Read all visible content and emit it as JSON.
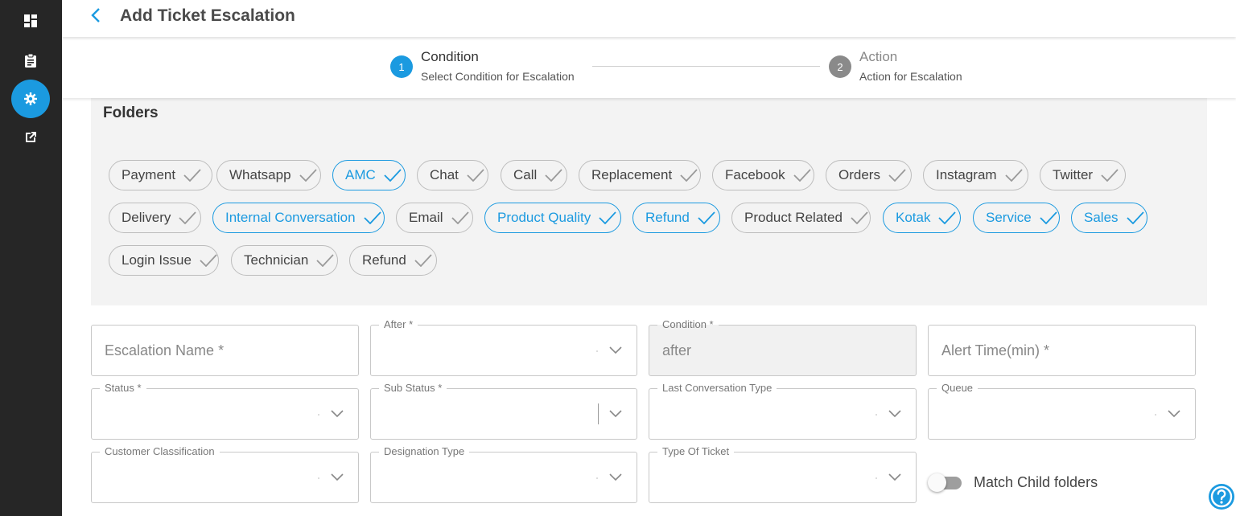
{
  "header": {
    "title": "Add Ticket Escalation"
  },
  "sidebar": {
    "items": [
      {
        "name": "dashboard",
        "icon": "dashboard-icon"
      },
      {
        "name": "tickets",
        "icon": "clipboard-icon"
      },
      {
        "name": "settings",
        "icon": "gear-icon",
        "active": true
      },
      {
        "name": "open-external",
        "icon": "external-link-icon"
      }
    ]
  },
  "stepper": {
    "steps": [
      {
        "number": "1",
        "title": "Condition",
        "subtitle": "Select Condition for Escalation",
        "active": true
      },
      {
        "number": "2",
        "title": "Action",
        "subtitle": "Action for Escalation",
        "active": false
      }
    ]
  },
  "folders": {
    "title": "Folders",
    "chips": [
      {
        "label": "Payment",
        "selected": false
      },
      {
        "label": "Whatsapp",
        "selected": false
      },
      {
        "label": "AMC",
        "selected": true
      },
      {
        "label": "Chat",
        "selected": false
      },
      {
        "label": "Call",
        "selected": false
      },
      {
        "label": "Replacement",
        "selected": false
      },
      {
        "label": "Facebook",
        "selected": false
      },
      {
        "label": "Orders",
        "selected": false
      },
      {
        "label": "Instagram",
        "selected": false
      },
      {
        "label": "Twitter",
        "selected": false
      },
      {
        "label": "Delivery",
        "selected": false
      },
      {
        "label": "Internal Conversation",
        "selected": true
      },
      {
        "label": "Email",
        "selected": false
      },
      {
        "label": "Product Quality",
        "selected": true
      },
      {
        "label": "Refund",
        "selected": true
      },
      {
        "label": "Product Related",
        "selected": false
      },
      {
        "label": "Kotak",
        "selected": true
      },
      {
        "label": "Service",
        "selected": true
      },
      {
        "label": "Sales",
        "selected": true
      },
      {
        "label": "Login Issue",
        "selected": false
      },
      {
        "label": "Technician",
        "selected": false
      },
      {
        "label": "Refund",
        "selected": false
      }
    ]
  },
  "form": {
    "escalation_name": {
      "placeholder": "Escalation Name *",
      "value": ""
    },
    "after": {
      "label": "After *",
      "value": ""
    },
    "condition": {
      "label": "Condition *",
      "value": "after"
    },
    "alert_time": {
      "placeholder": "Alert Time(min) *",
      "value": ""
    },
    "status": {
      "label": "Status *",
      "value": ""
    },
    "sub_status": {
      "label": "Sub Status *",
      "value": ""
    },
    "last_conversation_type": {
      "label": "Last Conversation Type",
      "value": ""
    },
    "queue": {
      "label": "Queue",
      "value": ""
    },
    "customer_classification": {
      "label": "Customer Classification",
      "value": ""
    },
    "designation_type": {
      "label": "Designation Type",
      "value": ""
    },
    "type_of_ticket": {
      "label": "Type Of Ticket",
      "value": ""
    },
    "match_child_folders": {
      "label": "Match Child folders",
      "enabled": false
    }
  },
  "colors": {
    "accent": "#1b9ae0",
    "sidebar_bg": "#262626",
    "panel_bg": "#f3f3f3",
    "inactive_step": "#8a8a8a"
  }
}
